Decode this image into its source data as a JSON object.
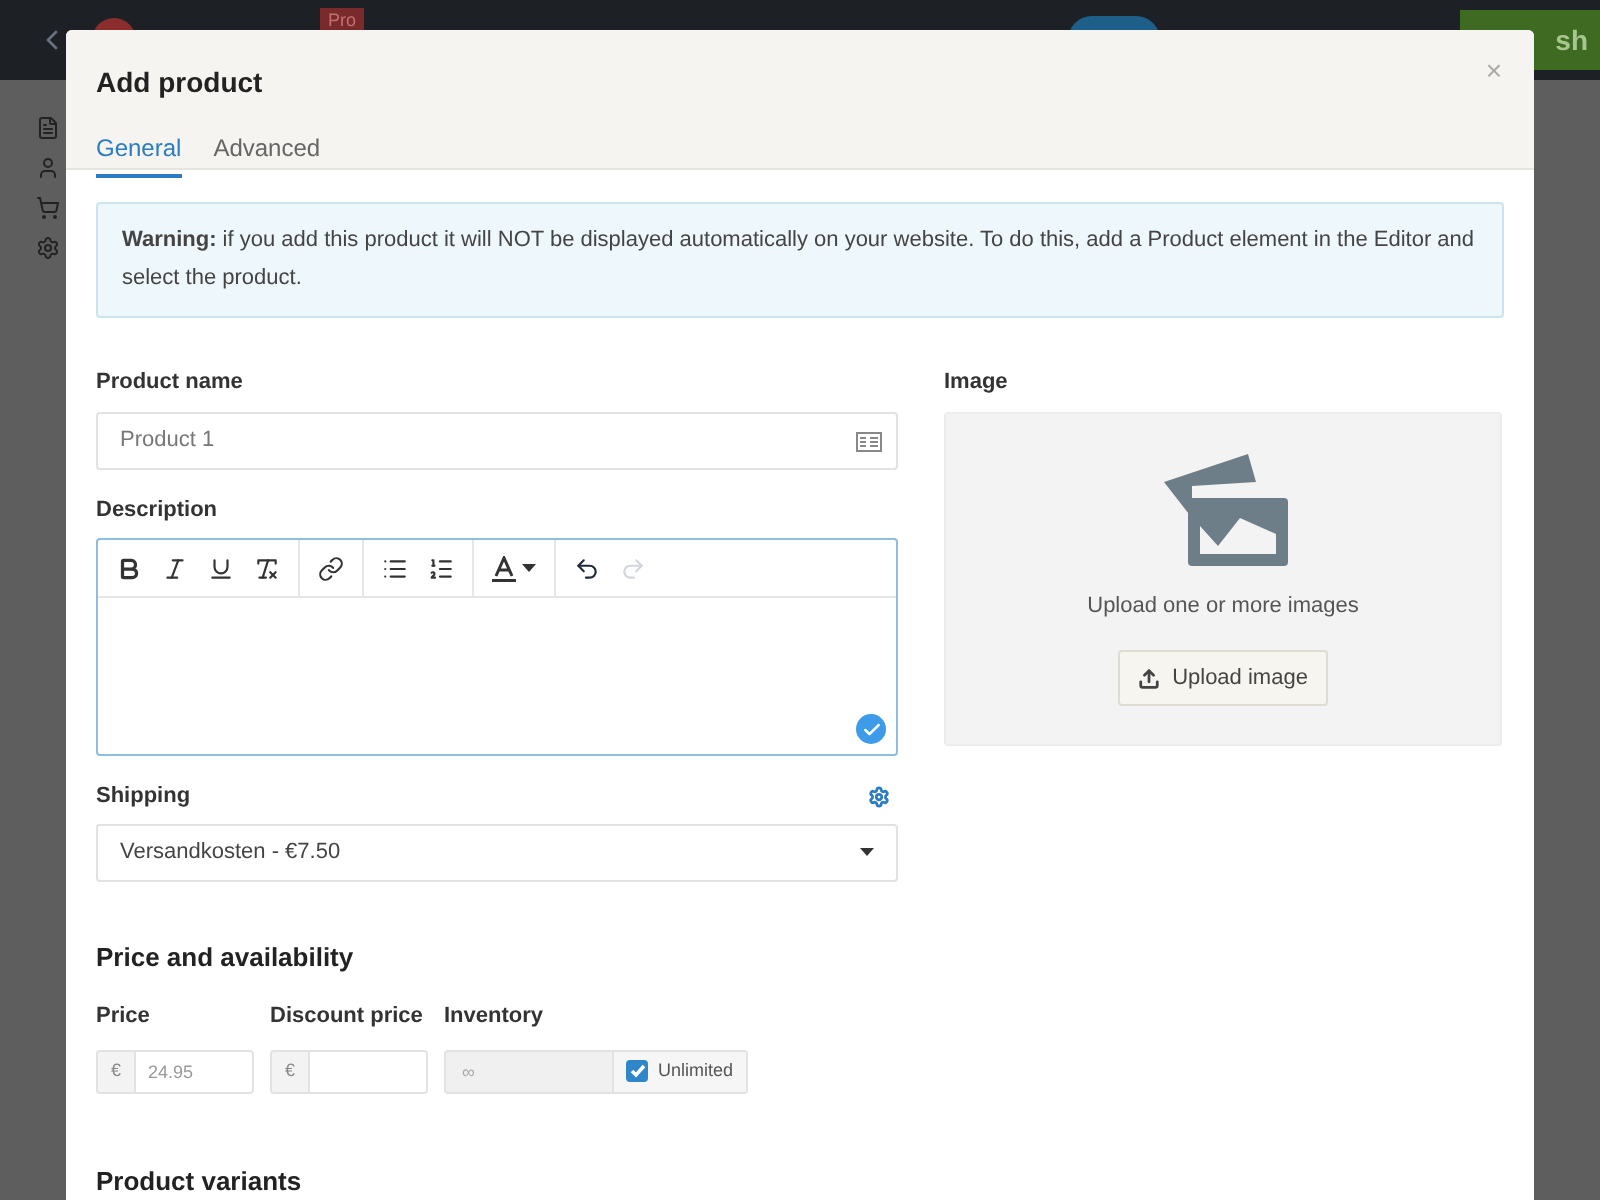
{
  "background": {
    "badge": "Pro",
    "publish_button": "sh"
  },
  "dialog": {
    "title": "Add product",
    "close": "×",
    "tabs": [
      {
        "label": "General",
        "selected": true
      },
      {
        "label": "Advanced",
        "selected": false
      }
    ],
    "warning": {
      "text": "**Warning:** if you add this product it will NOT be displayed automatically on your website. To do this, add a Product element in the Editor and select the product."
    },
    "product_name": {
      "label": "Product name",
      "placeholder": "Product 1"
    },
    "description": {
      "label": "Description",
      "toolbar": [
        [
          {
            "kind": "bold"
          },
          {
            "kind": "italic"
          },
          {
            "kind": "underline"
          },
          {
            "kind": "clear"
          }
        ],
        [
          {
            "kind": "link"
          }
        ],
        [
          {
            "kind": "bullets"
          },
          {
            "kind": "numbers"
          }
        ],
        [
          {
            "kind": "color"
          }
        ],
        [
          {
            "kind": "undo",
            "disabled": false
          },
          {
            "kind": "redo",
            "disabled": true
          }
        ]
      ]
    },
    "shipping": {
      "label": "Shipping",
      "value": "Versandkosten - €7.50"
    },
    "image": {
      "label": "Image",
      "hint": "Upload one or more images",
      "button": "Upload image"
    },
    "price_section": {
      "title": "Price and availability",
      "price": {
        "label": "Price",
        "prefix": "€",
        "placeholder": "24.95"
      },
      "discount_price": {
        "label": "Discount price",
        "prefix": "€"
      },
      "inventory": {
        "label": "Inventory",
        "placeholder": "∞",
        "unlimited_label": "Unlimited",
        "checked": true
      }
    },
    "variants": {
      "title": "Product variants"
    }
  }
}
